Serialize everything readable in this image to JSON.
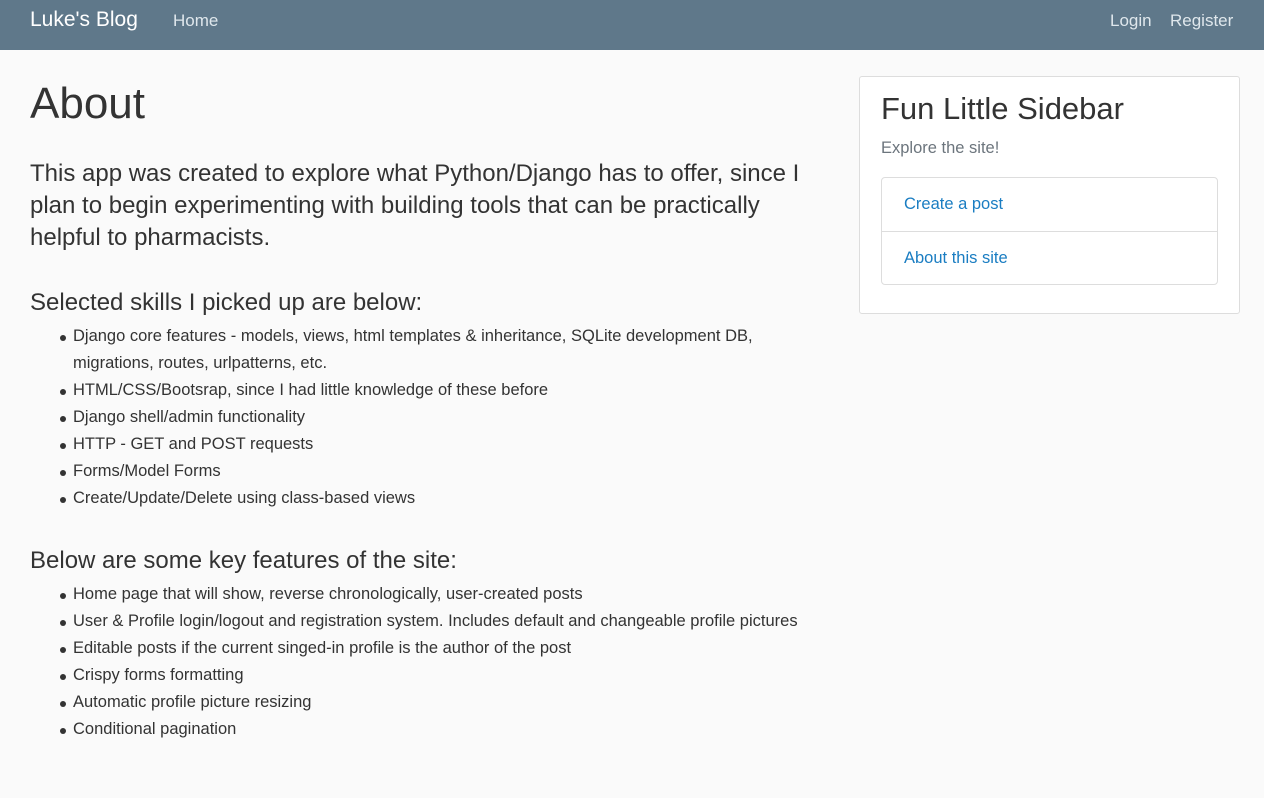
{
  "navbar": {
    "brand": "Luke's Blog",
    "home": "Home",
    "login": "Login",
    "register": "Register"
  },
  "main": {
    "title": "About",
    "lead": "This app was created to explore what Python/Django has to offer, since I plan to begin experimenting with building tools that can be practically helpful to pharmacists.",
    "skills_heading": "Selected skills I picked up are below:",
    "skills": [
      "Django core features - models, views, html templates & inheritance, SQLite development DB, migrations, routes, urlpatterns, etc.",
      "HTML/CSS/Bootsrap, since I had little knowledge of these before",
      "Django shell/admin functionality",
      "HTTP - GET and POST requests",
      "Forms/Model Forms",
      "Create/Update/Delete using class-based views"
    ],
    "features_heading": "Below are some key features of the site:",
    "features": [
      "Home page that will show, reverse chronologically, user-created posts",
      "User & Profile login/logout and registration system. Includes default and changeable profile pictures",
      "Editable posts if the current singed-in profile is the author of the post",
      "Crispy forms formatting",
      "Automatic profile picture resizing",
      "Conditional pagination"
    ]
  },
  "sidebar": {
    "title": "Fun Little Sidebar",
    "subtitle": "Explore the site!",
    "links": [
      "Create a post",
      "About this site"
    ]
  },
  "colors": {
    "navbar_bg": "#5f788a",
    "link": "#1a7dc2",
    "page_bg": "#fafafa"
  }
}
